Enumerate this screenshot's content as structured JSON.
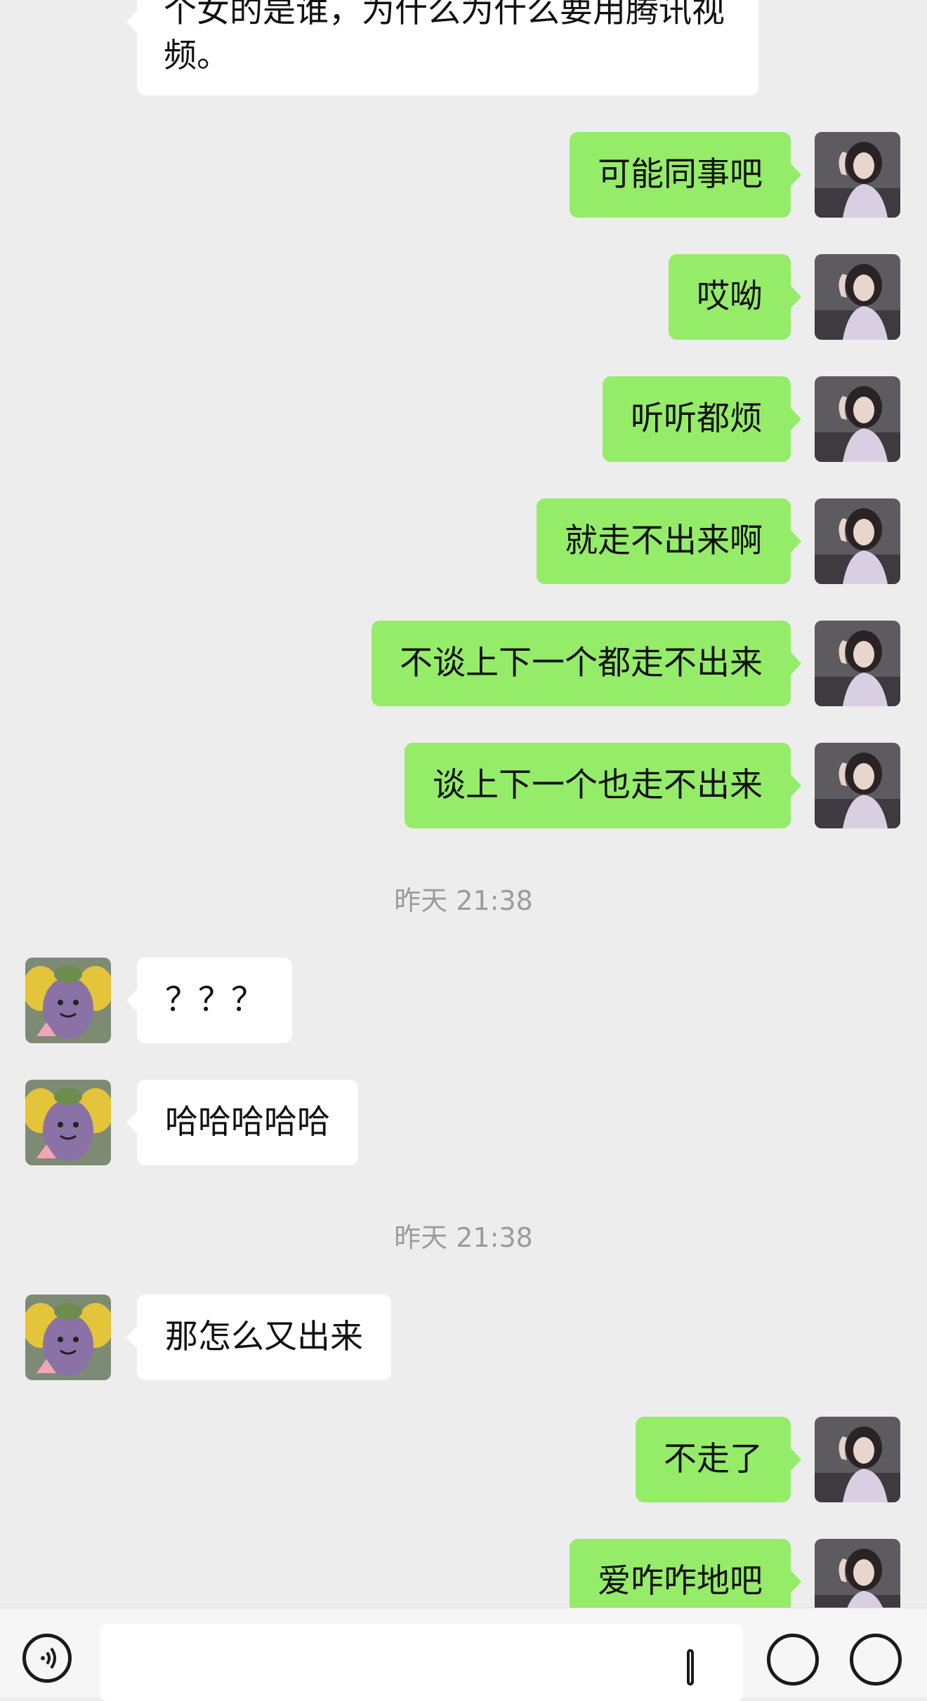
{
  "conversation": {
    "messages": [
      {
        "side": "them",
        "text": "个女的是谁，为什么为什么要用腾讯视频。"
      },
      {
        "side": "me",
        "text": "可能同事吧"
      },
      {
        "side": "me",
        "text": "哎呦"
      },
      {
        "side": "me",
        "text": "听听都烦"
      },
      {
        "side": "me",
        "text": "就走不出来啊"
      },
      {
        "side": "me",
        "text": "不谈上下一个都走不出来"
      },
      {
        "side": "me",
        "text": "谈上下一个也走不出来"
      },
      {
        "side": "time",
        "text": "昨天 21:38"
      },
      {
        "side": "them",
        "text": "？？？"
      },
      {
        "side": "them",
        "text": "哈哈哈哈哈"
      },
      {
        "side": "time",
        "text": "昨天 21:38"
      },
      {
        "side": "them",
        "text": "那怎么又出来"
      },
      {
        "side": "me",
        "text": "不走了"
      },
      {
        "side": "me",
        "text": "爱咋咋地吧"
      }
    ]
  },
  "input_bar": {
    "message_text": "",
    "icons": [
      "voice-icon",
      "emoji-icon",
      "add-icon"
    ]
  },
  "colors": {
    "background": "#ededed",
    "my_bubble": "#95ec69",
    "their_bubble": "#ffffff",
    "timestamp": "#9b9b9b"
  }
}
